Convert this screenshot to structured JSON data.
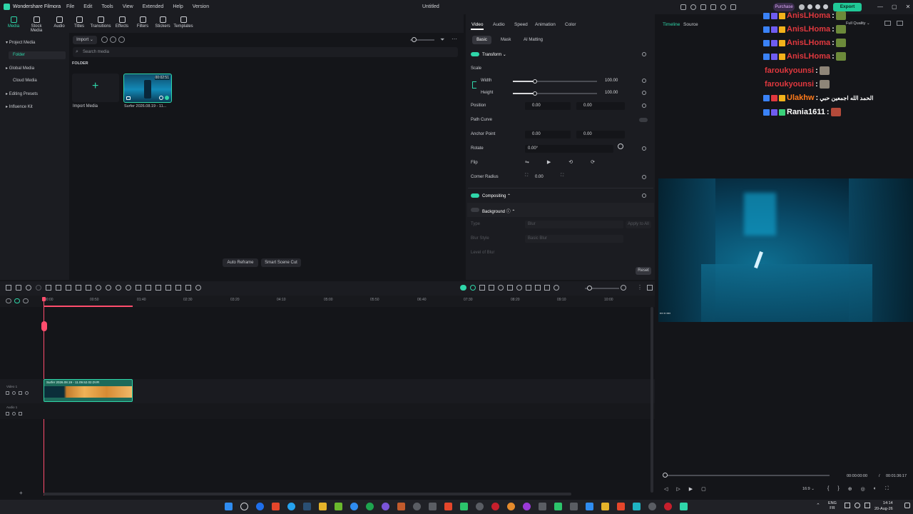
{
  "titlebar": {
    "app_name": "Wondershare Filmora",
    "menu": [
      "File",
      "Edit",
      "Tools",
      "View",
      "Extended",
      "Help",
      "Version"
    ],
    "document_title": "Untitled",
    "purchase_label": "Purchase",
    "export_label": "Export"
  },
  "toolbar": {
    "items": [
      {
        "label": "Media",
        "icon": "media-icon",
        "active": true
      },
      {
        "label": "Stock Media",
        "icon": "stock-media-icon"
      },
      {
        "label": "Audio",
        "icon": "audio-icon"
      },
      {
        "label": "Titles",
        "icon": "titles-icon"
      },
      {
        "label": "Transitions",
        "icon": "transitions-icon"
      },
      {
        "label": "Effects",
        "icon": "effects-icon"
      },
      {
        "label": "Filters",
        "icon": "filters-icon"
      },
      {
        "label": "Stickers",
        "icon": "stickers-icon"
      },
      {
        "label": "Templates",
        "icon": "templates-icon"
      }
    ]
  },
  "left_panel": {
    "items": [
      {
        "label": "Project Media",
        "expanded": true
      },
      {
        "label": "Folder",
        "selected": true
      },
      {
        "label": "Global Media"
      },
      {
        "label": "Cloud Media"
      },
      {
        "label": "Editing Presets"
      },
      {
        "label": "Influence Kit"
      }
    ]
  },
  "media": {
    "import_label": "Import",
    "search_placeholder": "Search media",
    "folder_label": "FOLDER",
    "import_media_label": "Import Media",
    "clip_name": "Surfer 2026.08.19 - 11...",
    "clip_duration": "00:02:51",
    "auto_reframe_label": "Auto Reframe",
    "smart_scene_cut_label": "Smart Scene Cut"
  },
  "properties": {
    "tabs": [
      "Video",
      "Audio",
      "Speed",
      "Animation",
      "Color"
    ],
    "subtabs": [
      "Basic",
      "Mask",
      "AI Matting"
    ],
    "transform_label": "Transform",
    "scale_label": "Scale",
    "width_label": "Width",
    "width_value": "100.00",
    "height_label": "Height",
    "height_value": "100.00",
    "scale_percent": 0.2,
    "position_label": "Position",
    "position_x": "0.00",
    "position_y": "0.00",
    "path_curve_label": "Path Curve",
    "anchor_label": "Anchor Point",
    "anchor_x": "0.00",
    "anchor_y": "0.00",
    "rotate_label": "Rotate",
    "rotate_value": "0.00°",
    "flip_label": "Flip",
    "corner_radius_label": "Corner Radius",
    "corner_radius_value": "0.00",
    "compositing_label": "Compositing",
    "background_label": "Background",
    "type_label": "Type",
    "type_value": "Blur",
    "apply_all_label": "Apply to All",
    "blur_style_label": "Blur Style",
    "blur_style_value": "Basic Blur",
    "level_label": "Level of Blur",
    "reset_label": "Reset"
  },
  "preview": {
    "tabs": [
      "Timeline",
      "Source"
    ],
    "quality": "Full Quality",
    "current_time": "00:00:00:00",
    "separator": "/",
    "total_time": "00:01:36:17",
    "ratio": "16:9"
  },
  "timeline": {
    "ruler": [
      "00:00",
      "00:50",
      "01:40",
      "02:30",
      "03:20",
      "04:10",
      "05:00",
      "05:50",
      "06:40",
      "07:30",
      "08:20",
      "09:10",
      "10:00"
    ],
    "video_track_label": "Video 1",
    "audio_track_label": "Audio 1",
    "clip_label": "Surfer 2026.08.19 - 11.09.52.02.DVR"
  },
  "chat": {
    "messages": [
      {
        "user": "AnisLHoma",
        "text": "",
        "color": "#e0383e"
      },
      {
        "user": "AnisLHoma",
        "text": "",
        "color": "#e0383e"
      },
      {
        "user": "AnisLHoma",
        "text": "",
        "color": "#e0383e"
      },
      {
        "user": "AnisLHoma",
        "text": "",
        "color": "#e0383e"
      },
      {
        "user": "faroukyounsi",
        "text": "",
        "color": "#e0383e"
      },
      {
        "user": "faroukyounsi",
        "text": "",
        "color": "#e0383e"
      },
      {
        "user": "Ulakhw",
        "text": "الحمد الله اجمعين حبي",
        "color": "#ff7a1a"
      },
      {
        "user": "Rania1611",
        "text": "",
        "color": "#ffffff"
      }
    ]
  },
  "taskbar": {
    "lang": "ENG",
    "region": "FR",
    "time": "14:14",
    "date": "20-Aug-26"
  },
  "colors": {
    "accent": "#2fd6a9",
    "playhead": "#ff4d6d",
    "export_bg": "#20c997"
  }
}
